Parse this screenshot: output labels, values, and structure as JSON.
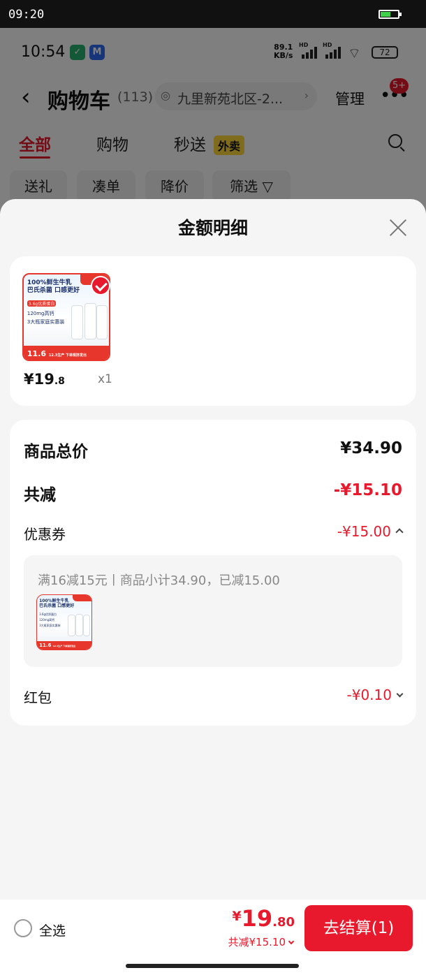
{
  "system_bar": {
    "time": "09:20"
  },
  "cart_page": {
    "status": {
      "time": "10:54",
      "app_icon_1": "✓",
      "app_icon_2": "M",
      "network_rate": "89.1",
      "network_unit": "KB/s",
      "hd_label": "HD",
      "battery": "72"
    },
    "header": {
      "title": "购物车",
      "count": "(113)",
      "address": "九里新苑北区-2...",
      "manage": "管理",
      "more_badge": "5+"
    },
    "tabs": [
      {
        "label": "全部"
      },
      {
        "label": "购物"
      },
      {
        "label": "秒送"
      }
    ],
    "waimai_tag": "外卖",
    "chips": [
      {
        "label": "送礼"
      },
      {
        "label": "凑单"
      },
      {
        "label": "降价"
      },
      {
        "label": "筛选"
      }
    ]
  },
  "sheet": {
    "title": "金额明细",
    "product": {
      "price_int": "¥19",
      "price_dec": ".8",
      "qty": "x1",
      "image": {
        "line1": "100%鲜生牛乳",
        "line2": "巴氏杀菌 口感更好",
        "tag": "3.6g优质蛋白",
        "line3": "120mg高钙",
        "line4": "3大瓶家庭实惠装",
        "bottom": "11.6",
        "bottom_note": "12.3生产 下单现挤发出"
      }
    },
    "summary": {
      "total_label": "商品总价",
      "total_value": "¥34.90",
      "discount_label": "共减",
      "discount_value": "-¥15.10",
      "coupon_label": "优惠券",
      "coupon_value": "-¥15.00",
      "coupon_detail": "满16减15元丨商品小计34.90，已减15.00",
      "redpacket_label": "红包",
      "redpacket_value": "-¥0.10"
    }
  },
  "bottom_bar": {
    "select_all": "全选",
    "currency": "¥",
    "total_int": "19",
    "total_dec": ".80",
    "saved": "共减¥15.10",
    "checkout": "去结算(1)"
  },
  "colors": {
    "accent_red": "#e8192c",
    "waimai_yellow": "#ffd83a"
  }
}
